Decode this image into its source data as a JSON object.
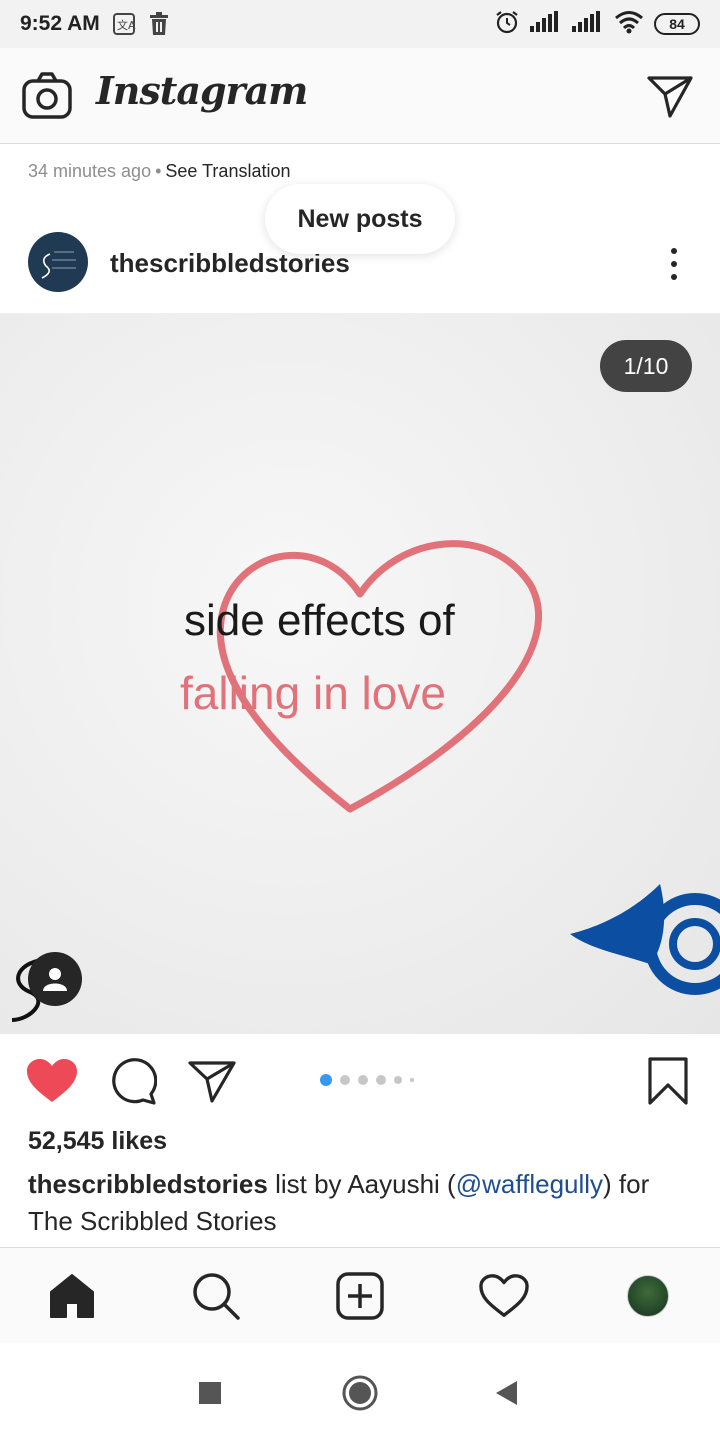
{
  "status_bar": {
    "time": "9:52 AM",
    "battery": "84"
  },
  "header": {
    "brand": "Instagram"
  },
  "previous_post": {
    "time_ago": "34 minutes ago",
    "separator": "•",
    "see_translation": "See Translation"
  },
  "new_posts_pill": "New posts",
  "post": {
    "username": "thescribbledstories",
    "counter": "1/10",
    "image_text_line1": "side effects of",
    "image_text_line2": "falling in love",
    "carousel_position": 1,
    "likes": "52,545 likes",
    "caption_user": "thescribbledstories",
    "caption_text_before": " list by Aayushi (",
    "caption_mention": "@wafflegully",
    "caption_text_after": ") for The Scribbled Stories"
  },
  "colors": {
    "heart_liked": "#ed4956",
    "carousel_active": "#3897f0",
    "image_heart": "#e2727a",
    "horn_blue": "#0b4ea2"
  },
  "icons": {
    "header_left": "camera-icon",
    "header_right": "direct-message-icon",
    "like": "heart-filled-icon",
    "comment": "comment-icon",
    "share": "send-icon",
    "save": "bookmark-icon",
    "nav": [
      "home-icon",
      "search-icon",
      "add-post-icon",
      "activity-heart-icon",
      "profile-avatar"
    ],
    "system": [
      "recents-square-icon",
      "home-circle-icon",
      "back-triangle-icon"
    ]
  }
}
